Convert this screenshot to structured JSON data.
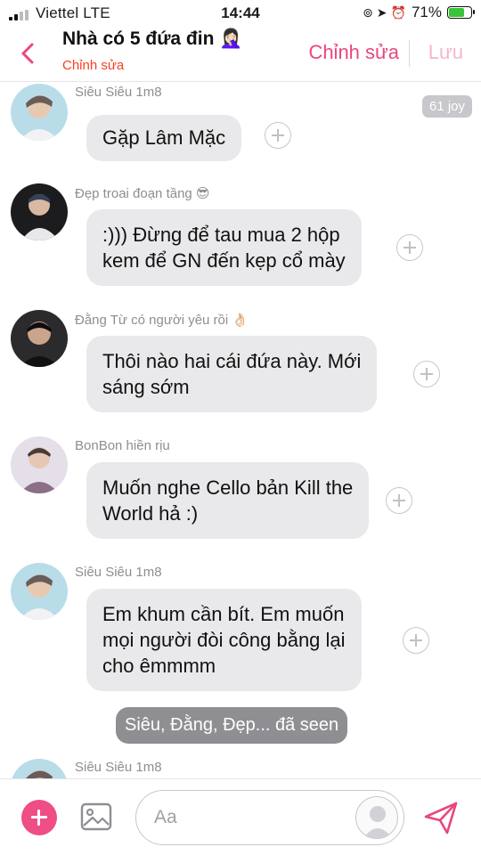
{
  "status_bar": {
    "carrier": "Viettel  LTE",
    "time": "14:44",
    "battery_percent": "71%",
    "battery_level": 0.71,
    "icons": [
      "signal-icon",
      "rotation-lock-icon",
      "location-icon",
      "alarm-icon",
      "battery-charging-icon"
    ]
  },
  "header": {
    "title": "Nhà có 5 đứa đin 🤦🏻‍♀️",
    "subtitle": "Chỉnh sửa",
    "edit_label": "Chỉnh sửa",
    "save_label": "Lưu",
    "accent_color": "#e9477d",
    "subtitle_color": "#ff3b1f"
  },
  "messages": [
    {
      "sender": "Siêu Siêu 1m8",
      "text": "Gặp Lâm Mặc",
      "badge": "61 joy"
    },
    {
      "sender": "Đẹp troai đoạn tầng 😎",
      "text": ":))) Đừng để tau mua 2 hộp\nkem để GN đến kẹp cổ mày"
    },
    {
      "sender": "Đằng Từ có người yêu rồi 👌🏻",
      "text": "Thôi nào hai cái đứa này. Mới\nsáng sớm"
    },
    {
      "sender": "BonBon hiền rịu",
      "text": "Muốn nghe Cello bản Kill the\nWorld hả :)"
    },
    {
      "sender": "Siêu Siêu 1m8",
      "text": "Em khum cần bít. Em muốn\nmọi người đòi công bằng lại\ncho êmmmm"
    },
    {
      "sender": "Siêu Siêu 1m8"
    }
  ],
  "seen_text": "Siêu, Đằng, Đẹp... đã seen",
  "input": {
    "placeholder": "Aa",
    "value": ""
  },
  "colors": {
    "bubble": "#e9e9eb",
    "seen_pill": "#8e8e93",
    "plus_button": "#ef4d85"
  }
}
